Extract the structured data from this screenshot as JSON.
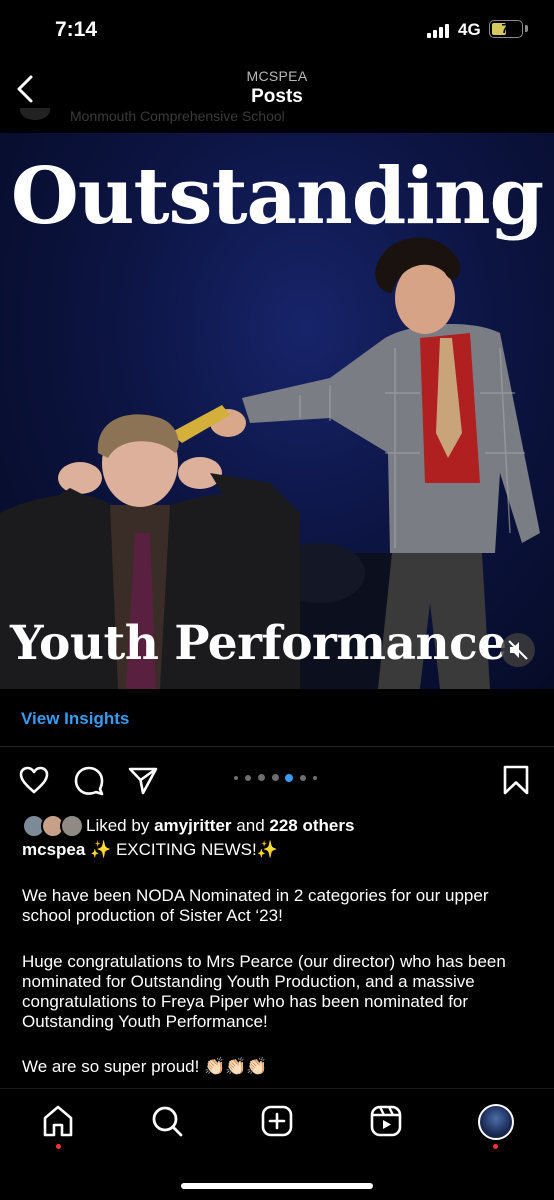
{
  "status_bar": {
    "time": "7:14",
    "network": "4G",
    "battery": "7"
  },
  "header": {
    "account": "MCSPEA",
    "title": "Posts",
    "partial_subtitle": "Monmouth Comprehensive School"
  },
  "post_image": {
    "overlay_title": "Outstanding",
    "overlay_subtitle": "Youth Performance",
    "carousel": {
      "count": 6,
      "active_index": 3
    }
  },
  "insights": {
    "label": "View Insights"
  },
  "likes": {
    "prefix": "Liked by",
    "user": "amyjritter",
    "middle": "and",
    "others": "228 others"
  },
  "caption": {
    "username": "mcspea",
    "headline": "✨ EXCITING NEWS!✨",
    "paragraph1": "We have been NODA Nominated in 2 categories for our upper school production of Sister Act ‘23!",
    "paragraph2": "Huge congratulations to Mrs Pearce (our director) who has been nominated for Outstanding Youth Production, and a massive congratulations to Freya Piper who has been nominated for Outstanding Youth Performance!",
    "paragraph3": "We are so super proud! 👏🏻👏🏻👏🏻"
  },
  "colors": {
    "link": "#3a9bf0",
    "notification": "#ff3040",
    "background": "#000000"
  },
  "icons": [
    "back-chevron-icon",
    "heart-icon",
    "comment-icon",
    "share-icon",
    "bookmark-icon",
    "mute-icon",
    "home-icon",
    "search-icon",
    "create-icon",
    "reels-icon"
  ]
}
